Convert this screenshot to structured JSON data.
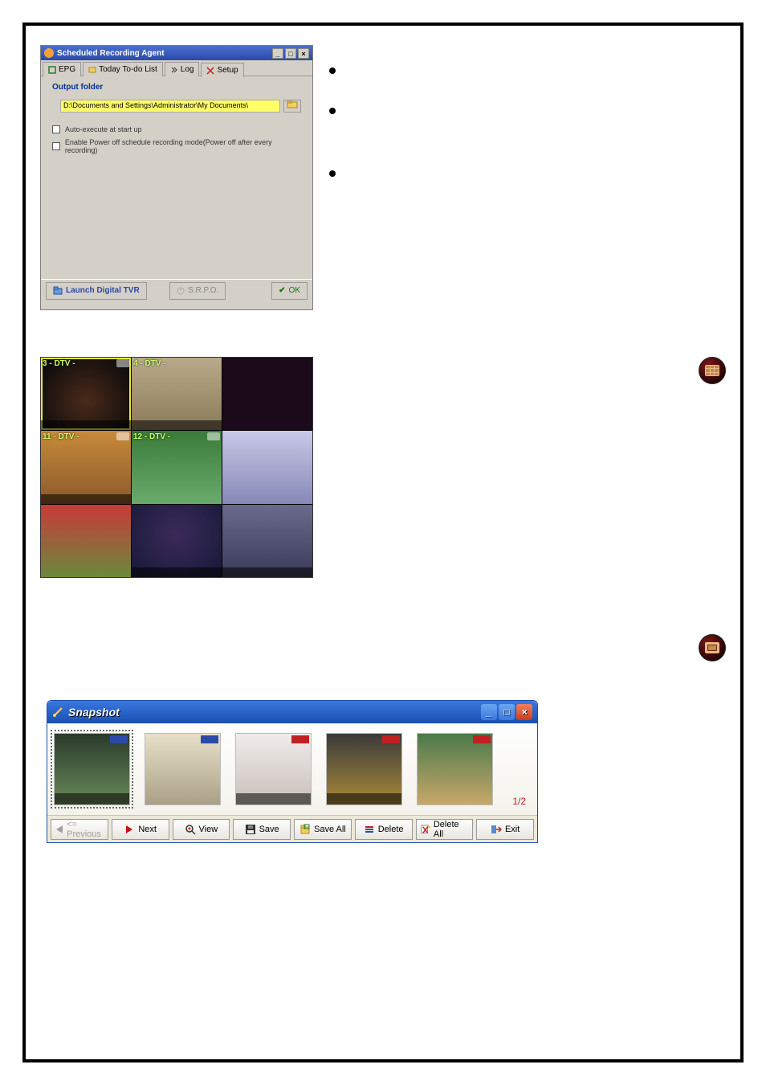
{
  "sra": {
    "title": "Scheduled Recording Agent",
    "tabs": {
      "epg": "EPG",
      "todo": "Today To-do List",
      "log": "Log",
      "setup": "Setup"
    },
    "section_label": "Output folder",
    "output_path": "D:\\Documents and Settings\\Administrator\\My Documents\\",
    "browse": "...",
    "cb1": "Auto-execute at start up",
    "cb2": "Enable Power off schedule recording mode(Power off after every recording)",
    "footer": {
      "launch": "Launch Digital TVR",
      "srpo": "S.R.P.O.",
      "ok": "OK"
    }
  },
  "tv": {
    "cells": [
      {
        "caption": "3 - DTV -"
      },
      {
        "caption": "4 - DTV -"
      },
      {
        "caption": ""
      },
      {
        "caption": "11 - DTV -"
      },
      {
        "caption": "12 - DTV -"
      },
      {
        "caption": ""
      },
      {
        "caption": ""
      },
      {
        "caption": ""
      },
      {
        "caption": ""
      }
    ]
  },
  "snapshot": {
    "title": "Snapshot",
    "page_indicator": "1/2",
    "buttons": {
      "prev": "<= Previous",
      "next": "Next",
      "view": "View",
      "save": "Save",
      "saveall": "Save All",
      "del": "Delete",
      "delall": "Delete All",
      "exit": "Exit"
    }
  }
}
